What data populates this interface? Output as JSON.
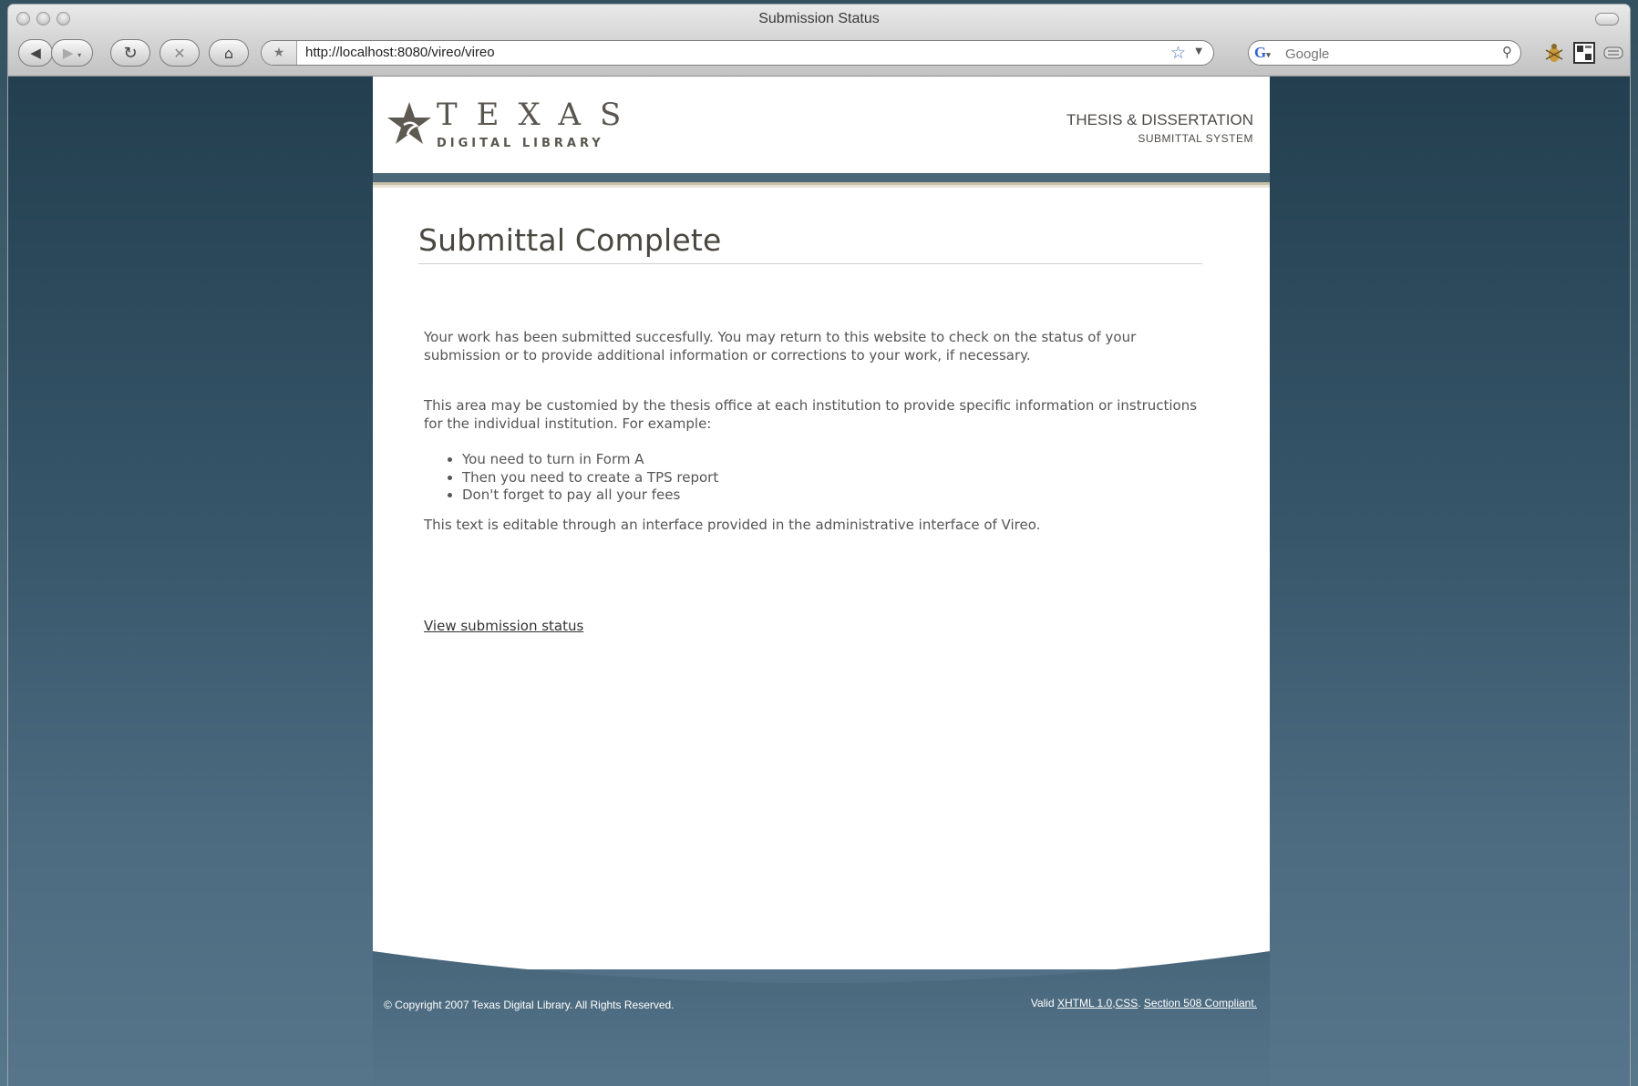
{
  "window": {
    "title": "Submission Status"
  },
  "toolbar": {
    "url": "http://localhost:8080/vireo/vireo",
    "search_placeholder": "Google"
  },
  "header": {
    "logo_word": "TEXAS",
    "logo_subtitle": "DIGITAL LIBRARY",
    "brand_line1": "THESIS & DISSERTATION",
    "brand_line2": "SUBMITTAL SYSTEM"
  },
  "main": {
    "heading": "Submittal Complete",
    "para1": "Your work has been submitted succesfully. You may return to this website to check on the status of your submission or to provide additional information or corrections to your work, if necessary.",
    "para2": "This area may be customied by the thesis office at each institution to provide specific information or instructions for the individual institution. For example:",
    "bullets": [
      "You need to turn in Form A",
      "Then you need to create a TPS report",
      "Don't forget to pay all your fees"
    ],
    "para3": "This text is editable through an interface provided in the administrative interface of Vireo.",
    "status_link": "View submission status"
  },
  "footer": {
    "copyright": "© Copyright 2007 Texas Digital Library. All Rights Reserved.",
    "valid_prefix": "Valid",
    "xhtml_link": "XHTML 1.0",
    "css_link": "CSS",
    "section508_link": "Section 508 Compliant."
  },
  "colors": {
    "band": "#4a6878",
    "heading_text": "#4a4640",
    "body_text": "#555555",
    "search_g": "#3366cc"
  },
  "icons": [
    "back-icon",
    "forward-icon",
    "reload-icon",
    "stop-icon",
    "home-icon",
    "bookmark-star-icon",
    "google-icon",
    "magnifier-icon",
    "bug-icon",
    "grid-icon",
    "menu-icon"
  ]
}
